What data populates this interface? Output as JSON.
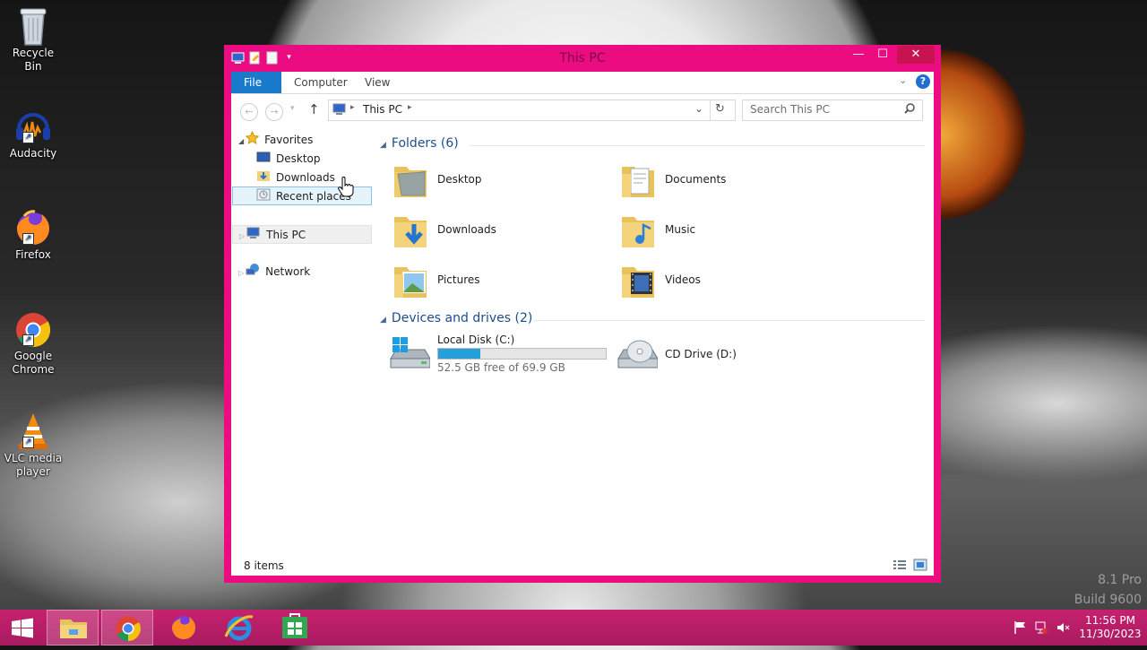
{
  "desktop": {
    "icons": [
      {
        "label": "Recycle Bin"
      },
      {
        "label": "Audacity"
      },
      {
        "label": "Firefox"
      },
      {
        "label": "Google Chrome"
      },
      {
        "label": "VLC media player"
      }
    ],
    "watermark": {
      "line1": "8.1 Pro",
      "line2": "Build 9600"
    }
  },
  "window": {
    "title": "This PC",
    "accent": "#ec0c82",
    "controls": {
      "minimize": "—",
      "maximize": "☐",
      "close": "✕"
    },
    "ribbon": {
      "tabs": [
        "File",
        "Computer",
        "View"
      ],
      "help": "?"
    },
    "address": {
      "path": "This PC"
    },
    "search": {
      "placeholder": "Search This PC"
    },
    "nav": {
      "favorites": "Favorites",
      "favorite_items": [
        "Desktop",
        "Downloads",
        "Recent places"
      ],
      "this_pc": "This PC",
      "network": "Network"
    },
    "folders": {
      "header": "Folders (6)",
      "items": [
        "Desktop",
        "Documents",
        "Downloads",
        "Music",
        "Pictures",
        "Videos"
      ]
    },
    "devices": {
      "header": "Devices and drives (2)",
      "local_disk": {
        "name": "Local Disk (C:)",
        "free_text": "52.5 GB free of 69.9 GB",
        "used_fraction": 0.249
      },
      "cd_drive": {
        "name": "CD Drive (D:)"
      }
    },
    "status": {
      "items": "8 items"
    }
  },
  "taskbar": {
    "clock": {
      "time": "11:56 PM",
      "date": "11/30/2023"
    },
    "apps": [
      "start-button",
      "file-explorer",
      "google-chrome",
      "firefox",
      "internet-explorer",
      "store"
    ]
  }
}
